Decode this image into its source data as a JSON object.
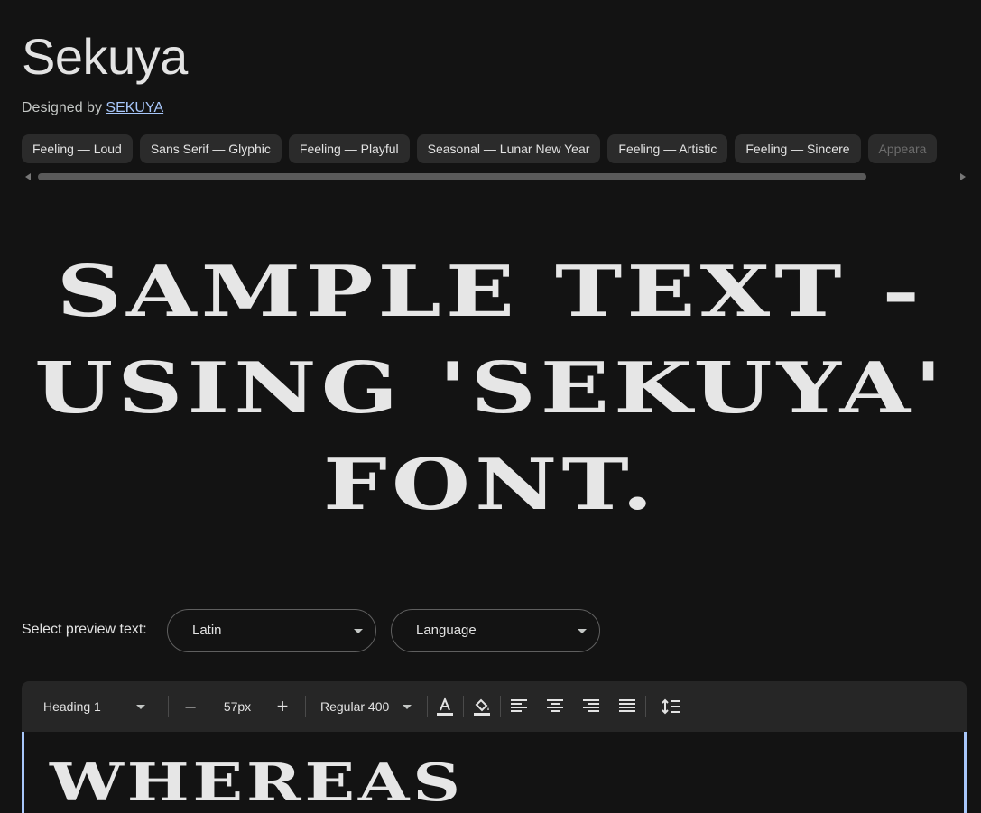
{
  "font": {
    "name": "Sekuya",
    "designed_by_prefix": "Designed by",
    "designer": "SEKUYA"
  },
  "tags": [
    "Feeling — Loud",
    "Sans Serif — Glyphic",
    "Feeling — Playful",
    "Seasonal — Lunar New Year",
    "Feeling — Artistic",
    "Feeling — Sincere",
    "Appeara"
  ],
  "sample": {
    "text": "SAMPLE TEXT - USING 'SEKUYA' FONT."
  },
  "preview": {
    "label": "Select preview text:",
    "script_value": "Latin",
    "language_value": "Language"
  },
  "toolbar": {
    "style_value": "Heading 1",
    "decrease_label": "–",
    "size_value": "57px",
    "increase_label": "+",
    "weight_value": "Regular 400"
  },
  "editor": {
    "text": "WHEREAS"
  },
  "colors": {
    "background": "#131313",
    "chip": "#2b2b2b",
    "accent": "#a8c7fa",
    "text": "#e3e3e3"
  }
}
